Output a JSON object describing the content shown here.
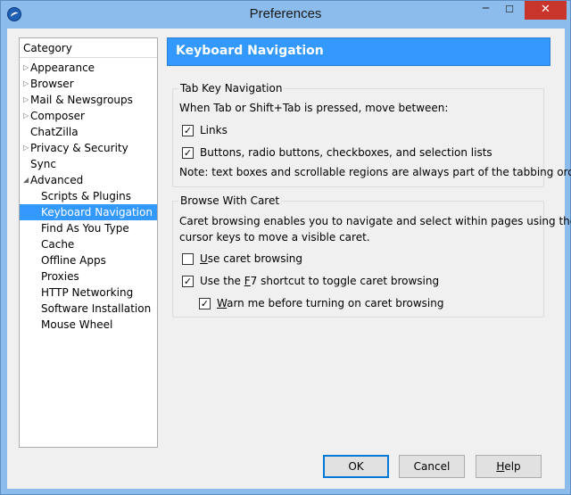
{
  "window": {
    "title": "Preferences",
    "controls": {
      "minimize": "─",
      "maximize": "☐",
      "close": "✕"
    }
  },
  "sidebar": {
    "header": "Category",
    "items": [
      {
        "label": "Appearance",
        "level": 0,
        "expander": "collapsed"
      },
      {
        "label": "Browser",
        "level": 0,
        "expander": "collapsed"
      },
      {
        "label": "Mail & Newsgroups",
        "level": 0,
        "expander": "collapsed"
      },
      {
        "label": "Composer",
        "level": 0,
        "expander": "collapsed"
      },
      {
        "label": "ChatZilla",
        "level": 0,
        "expander": "none"
      },
      {
        "label": "Privacy & Security",
        "level": 0,
        "expander": "collapsed"
      },
      {
        "label": "Sync",
        "level": 0,
        "expander": "none"
      },
      {
        "label": "Advanced",
        "level": 0,
        "expander": "expanded"
      },
      {
        "label": "Scripts & Plugins",
        "level": 1
      },
      {
        "label": "Keyboard Navigation",
        "level": 1,
        "selected": true
      },
      {
        "label": "Find As You Type",
        "level": 1
      },
      {
        "label": "Cache",
        "level": 1
      },
      {
        "label": "Offline Apps",
        "level": 1
      },
      {
        "label": "Proxies",
        "level": 1
      },
      {
        "label": "HTTP Networking",
        "level": 1
      },
      {
        "label": "Software Installation",
        "level": 1
      },
      {
        "label": "Mouse Wheel",
        "level": 1
      }
    ]
  },
  "page": {
    "title": "Keyboard Navigation",
    "tab_group": {
      "legend": "Tab Key Navigation",
      "intro": "When Tab or Shift+Tab is pressed, move between:",
      "links": {
        "label": "Links",
        "checked": true
      },
      "controls": {
        "label": "Buttons, radio buttons, checkboxes, and selection lists",
        "checked": true
      },
      "note": "Note: text boxes and scrollable regions are always part of the tabbing order."
    },
    "caret_group": {
      "legend": "Browse With Caret",
      "desc_line1": "Caret browsing enables you to navigate and select within pages using the",
      "desc_line2": "cursor keys to move a visible caret.",
      "use_caret": {
        "label": "Use caret browsing",
        "checked": false
      },
      "f7_toggle": {
        "label": "Use the F7 shortcut to toggle caret browsing",
        "checked": true
      },
      "warn": {
        "label": "Warn me before turning on caret browsing",
        "checked": true
      }
    }
  },
  "buttons": {
    "ok": "OK",
    "cancel": "Cancel",
    "help": "Help"
  },
  "colors": {
    "selection": "#3399ff",
    "header": "#3399ff",
    "close": "#c7352b",
    "frame": "#8cbcec"
  }
}
